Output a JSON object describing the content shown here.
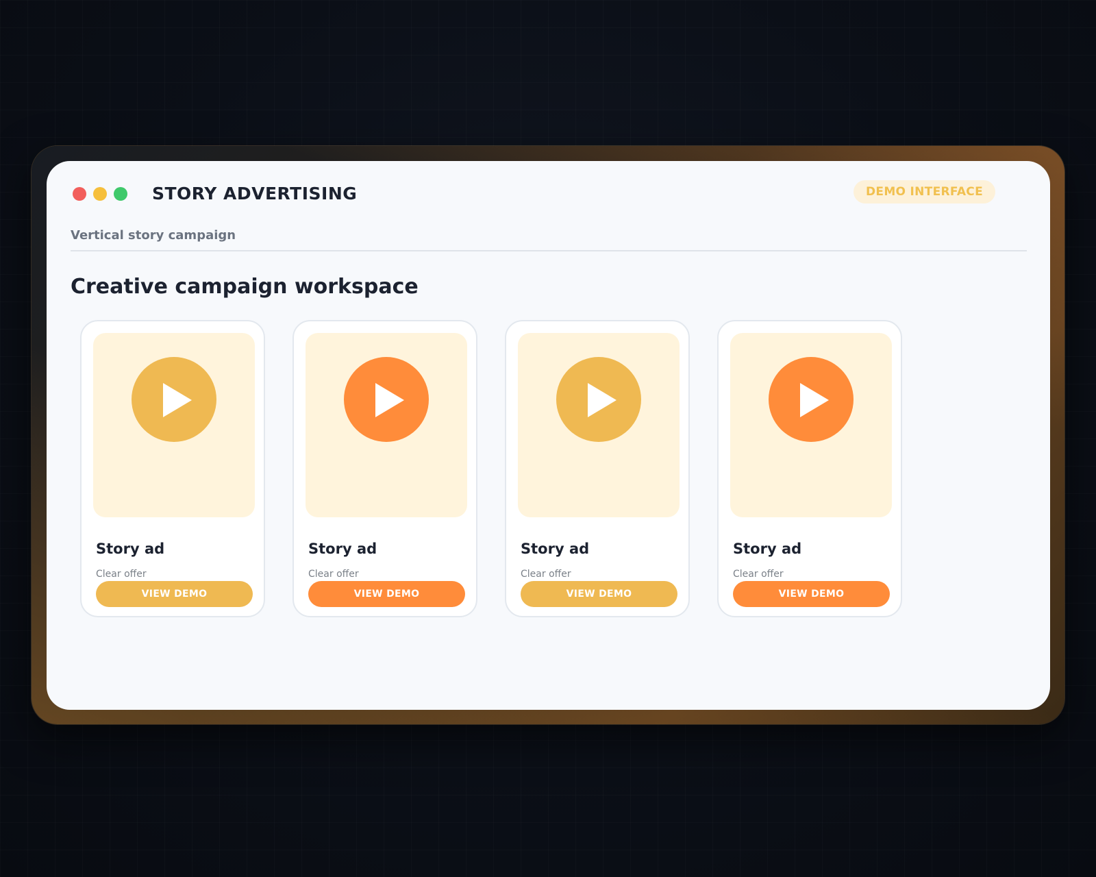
{
  "window": {
    "title": "STORY ADVERTISING",
    "badge": "DEMO INTERFACE",
    "subtitle": "Vertical story campaign",
    "heading": "Creative campaign workspace",
    "controls": [
      {
        "name": "close",
        "color": "#f25f5c"
      },
      {
        "name": "minimize",
        "color": "#f6bf3c"
      },
      {
        "name": "maximize",
        "color": "#3fc96b"
      }
    ]
  },
  "colors": {
    "yellow": "#efb952",
    "orange": "#ff8c3a",
    "badge_text": "#f1c04f"
  },
  "cards": [
    {
      "title": "Story ad",
      "subtitle": "Clear offer",
      "button": "VIEW DEMO",
      "accent": "#efb952",
      "icon": "play-icon"
    },
    {
      "title": "Story ad",
      "subtitle": "Clear offer",
      "button": "VIEW DEMO",
      "accent": "#ff8c3a",
      "icon": "play-icon"
    },
    {
      "title": "Story ad",
      "subtitle": "Clear offer",
      "button": "VIEW DEMO",
      "accent": "#efb952",
      "icon": "play-icon"
    },
    {
      "title": "Story ad",
      "subtitle": "Clear offer",
      "button": "VIEW DEMO",
      "accent": "#ff8c3a",
      "icon": "play-icon"
    }
  ]
}
